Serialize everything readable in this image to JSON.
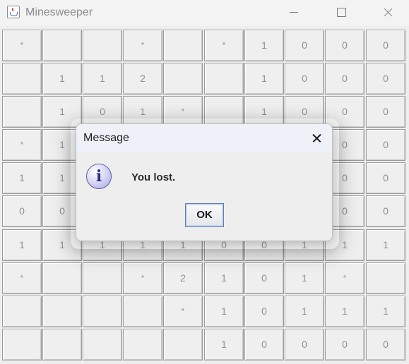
{
  "window": {
    "title": "Minesweeper",
    "icon": "java-coffee-cup-icon"
  },
  "board": {
    "rows": [
      [
        "*",
        "",
        "",
        "*",
        "",
        "*",
        "1",
        "0",
        "0",
        "0"
      ],
      [
        "",
        "1",
        "1",
        "2",
        "",
        "",
        "1",
        "0",
        "0",
        "0"
      ],
      [
        "",
        "1",
        "0",
        "1",
        "*",
        "",
        "1",
        "0",
        "0",
        "0"
      ],
      [
        "*",
        "1",
        "",
        "",
        "",
        "",
        "",
        "",
        "0",
        "0"
      ],
      [
        "1",
        "1",
        "",
        "",
        "",
        "",
        "",
        "",
        "0",
        "0"
      ],
      [
        "0",
        "0",
        "",
        "",
        "",
        "",
        "",
        "",
        "0",
        "0"
      ],
      [
        "1",
        "1",
        "1",
        "1",
        "1",
        "0",
        "0",
        "1",
        "1",
        "1"
      ],
      [
        "*",
        "",
        "",
        "*",
        "2",
        "1",
        "0",
        "1",
        "*",
        ""
      ],
      [
        "",
        "",
        "",
        "",
        "*",
        "1",
        "0",
        "1",
        "1",
        "1"
      ],
      [
        "",
        "",
        "",
        "",
        "",
        "1",
        "0",
        "0",
        "0",
        "0"
      ]
    ]
  },
  "dialog": {
    "title": "Message",
    "icon": "info-icon",
    "message": "You lost.",
    "ok_label": "OK"
  }
}
